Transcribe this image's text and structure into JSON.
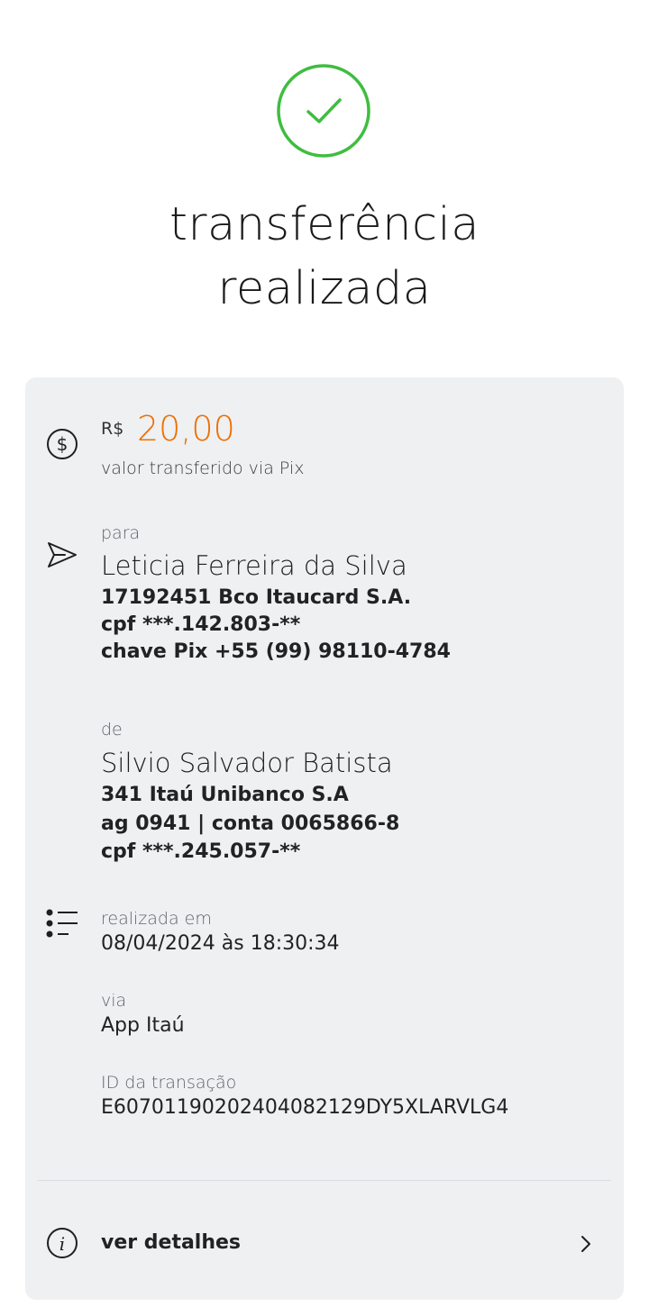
{
  "header": {
    "title_line1": "transferência",
    "title_line2": "realizada"
  },
  "amount": {
    "currency": "R$",
    "value": "20,00",
    "caption": "valor transferido via Pix"
  },
  "recipient": {
    "label": "para",
    "name": "Leticia Ferreira da Silva",
    "bank": "17192451 Bco Itaucard S.A.",
    "cpf": "cpf ***.142.803-**",
    "pix_key": "chave Pix +55 (99) 98110-4784"
  },
  "sender": {
    "label": "de",
    "name": "Silvio Salvador Batista",
    "bank": "341 Itaú Unibanco S.A",
    "account": "ag 0941 | conta 0065866-8",
    "cpf": "cpf ***.245.057-**"
  },
  "info": {
    "date_label": "realizada em",
    "date_value": "08/04/2024 às 18:30:34",
    "via_label": "via",
    "via_value": "App Itaú",
    "id_label": "ID da transação",
    "id_value": "E60701190202404082129DY5XLARVLG4"
  },
  "details": {
    "label": "ver detalhes"
  },
  "colors": {
    "success": "#3fbd3f",
    "accent": "#ec7000",
    "card_bg": "#eff0f2"
  },
  "icons": {
    "success": "check-circle-icon",
    "amount": "dollar-circle-icon",
    "recipient": "send-icon",
    "info": "list-icon",
    "details": "info-icon",
    "arrow": "chevron-right-icon"
  }
}
